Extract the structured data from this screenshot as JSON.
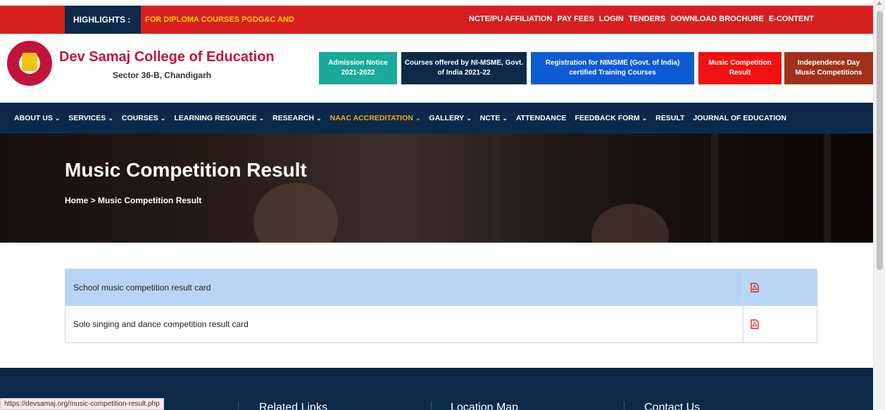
{
  "topbar": {
    "highlights_label": "HIGHLIGHTS :",
    "highlights_text": "FOR DIPLOMA COURSES PGDG&C AND",
    "links": [
      "NCTE/PU AFFILIATION",
      "PAY FEES",
      "LOGIN",
      "TENDERS",
      "DOWNLOAD BROCHURE",
      "E-CONTENT"
    ]
  },
  "header": {
    "college_name": "Dev Samaj College of Education",
    "address": "Sector 36-B, Chandigarh",
    "notices": [
      {
        "label": "Admission Notice 2021-2022",
        "color": "#1aa99a"
      },
      {
        "label": "Courses offered by NI-MSME, Govt. of India 2021-22",
        "color": "#0b2a4a"
      },
      {
        "label": "Registration for NIMSME (Govt. of India) certified Training Courses",
        "color": "#0d5bd3"
      },
      {
        "label": "Music Competition Result",
        "color": "#ee1212"
      },
      {
        "label": "Independence Day Music Competitions",
        "color": "#a0321c"
      }
    ]
  },
  "nav": {
    "items": [
      {
        "label": "ABOUT US",
        "dropdown": true
      },
      {
        "label": "SERVICES",
        "dropdown": true
      },
      {
        "label": "COURSES",
        "dropdown": true
      },
      {
        "label": "LEARNING RESOURCE",
        "dropdown": true
      },
      {
        "label": "RESEARCH",
        "dropdown": true
      },
      {
        "label": "NAAC ACCREDITATION",
        "dropdown": true,
        "active": true
      },
      {
        "label": "GALLERY",
        "dropdown": true
      },
      {
        "label": "NCTE",
        "dropdown": true
      },
      {
        "label": "ATTENDANCE",
        "dropdown": false
      },
      {
        "label": "FEEDBACK FORM",
        "dropdown": true
      },
      {
        "label": "RESULT",
        "dropdown": false
      },
      {
        "label": "JOURNAL OF EDUCATION",
        "dropdown": false
      }
    ],
    "active_color": "#f5a623"
  },
  "hero": {
    "title": "Music Competition Result",
    "breadcrumb_home": "Home",
    "breadcrumb_sep": ">",
    "breadcrumb_current": "Music Competition Result"
  },
  "results": {
    "rows": [
      {
        "title": "School music competition result card",
        "icon": "pdf-icon",
        "highlighted": true
      },
      {
        "title": "Solo singing and dance competition result card",
        "icon": "pdf-icon",
        "highlighted": false
      }
    ]
  },
  "footer": {
    "headings": [
      "Related Links",
      "Location Map",
      "Contact Us"
    ]
  },
  "status_url": "https://devsamaj.org/music-competition-result.php",
  "colors": {
    "top_bar": "#d71f1f",
    "navy": "#0b2a4a",
    "brand_red": "#c0143c",
    "pdf_red": "#e02424",
    "row_highlight": "#b9d5f5"
  }
}
